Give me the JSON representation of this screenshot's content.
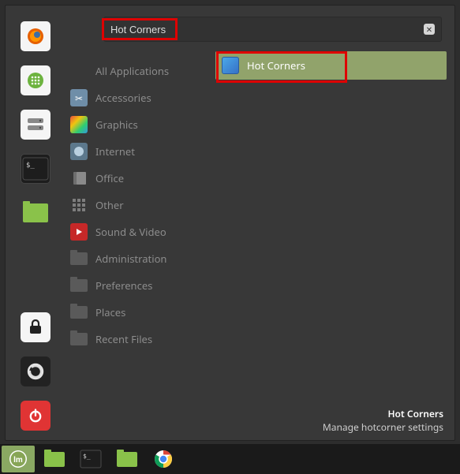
{
  "search": {
    "value": "Hot Corners"
  },
  "categories": [
    {
      "id": "all",
      "label": "All Applications"
    },
    {
      "id": "accessories",
      "label": "Accessories"
    },
    {
      "id": "graphics",
      "label": "Graphics"
    },
    {
      "id": "internet",
      "label": "Internet"
    },
    {
      "id": "office",
      "label": "Office"
    },
    {
      "id": "other",
      "label": "Other"
    },
    {
      "id": "soundvideo",
      "label": "Sound & Video"
    },
    {
      "id": "admin",
      "label": "Administration"
    },
    {
      "id": "prefs",
      "label": "Preferences"
    },
    {
      "id": "places",
      "label": "Places"
    },
    {
      "id": "recent",
      "label": "Recent Files"
    }
  ],
  "favorites": {
    "top": [
      "firefox",
      "apps",
      "drives",
      "terminal",
      "files"
    ],
    "bottom": [
      "lock",
      "logout",
      "power"
    ]
  },
  "result": {
    "label": "Hot Corners"
  },
  "tooltip": {
    "title": "Hot Corners",
    "desc": "Manage hotcorner settings"
  },
  "taskbar": [
    "menu",
    "files",
    "terminal",
    "files2",
    "chrome"
  ]
}
